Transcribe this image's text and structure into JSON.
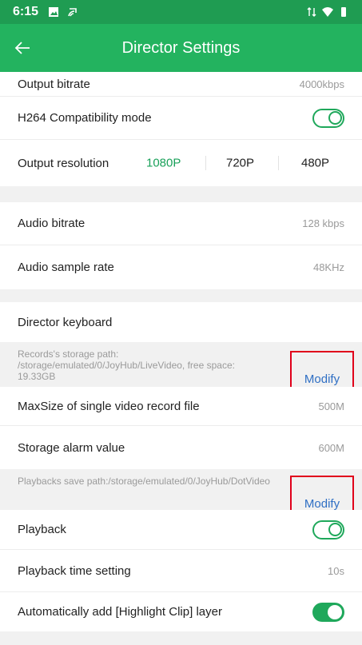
{
  "status_bar": {
    "time": "6:15"
  },
  "app_bar": {
    "title": "Director Settings"
  },
  "settings": {
    "output_bitrate": {
      "label": "Output bitrate",
      "value": "4000kbps"
    },
    "h264": {
      "label": "H264 Compatibility mode",
      "enabled": false
    },
    "output_resolution": {
      "label": "Output resolution",
      "options": [
        "1080P",
        "720P",
        "480P"
      ],
      "selected": "1080P"
    },
    "audio_bitrate": {
      "label": "Audio bitrate",
      "value": "128 kbps"
    },
    "audio_sample_rate": {
      "label": "Audio sample rate",
      "value": "48KHz"
    },
    "director_keyboard": {
      "label": "Director keyboard"
    },
    "records_path": {
      "text": "Records's storage path: /storage/emulated/0/JoyHub/LiveVideo, free space: 19.33GB",
      "button": "Modify"
    },
    "max_size": {
      "label": "MaxSize of single video record file",
      "value": "500M"
    },
    "storage_alarm": {
      "label": "Storage alarm value",
      "value": "600M"
    },
    "playbacks_path": {
      "text": "Playbacks save path:/storage/emulated/0/JoyHub/DotVideo",
      "button": "Modify"
    },
    "playback": {
      "label": "Playback",
      "enabled": false
    },
    "playback_time": {
      "label": "Playback time setting",
      "value": "10s"
    },
    "highlight_clip": {
      "label": "Automatically add [Highlight Clip] layer",
      "enabled": true
    }
  },
  "colors": {
    "status_bar": "#1f9c52",
    "app_bar": "#23b35f",
    "accent": "#1fa85b",
    "link": "#2f6fc4",
    "highlight_box": "#e0001b"
  },
  "icons": [
    "image-icon",
    "cast-icon",
    "data-icon",
    "wifi-icon",
    "battery-icon",
    "back-arrow-icon"
  ]
}
